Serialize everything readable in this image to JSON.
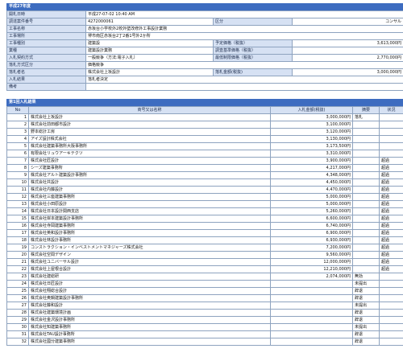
{
  "section1": {
    "title": "平成27年度",
    "rows": [
      {
        "label": "開札日時",
        "value": "平成27-07-02 10:40 AM"
      },
      {
        "label": "調達案件番号",
        "value": "4272000061",
        "label2": "区分",
        "value2": "コンサル"
      },
      {
        "label": "工事名称",
        "value": "赤坂台小学校外2校外壁改修外工事設計業務"
      },
      {
        "label": "工事場所",
        "value": "堺市南区赤坂台2丁2番1号外2か所"
      },
      {
        "label": "工事種別",
        "value": "建築設",
        "label2": "予定価格（税抜）",
        "value2": "3,613,000円"
      },
      {
        "label": "業種",
        "value": "建築設計業務",
        "label2": "調査基準価格（税抜）",
        "value2": ""
      },
      {
        "label": "入札契約方式",
        "value": "一般競争（方法:電子入札）",
        "label2": "最低制限価格（税抜）",
        "value2": "2,770,000円"
      },
      {
        "label": "落札方式区分",
        "value": "価格競争"
      },
      {
        "label": "落札者名",
        "value": "株式会社上坂設計",
        "label2": "落札金額(税抜)",
        "value2": "3,000,000円"
      },
      {
        "label": "入札結果",
        "value": "落札者決定"
      },
      {
        "label": "備考",
        "value": ""
      }
    ]
  },
  "section2": {
    "title": "第1回入札結果",
    "headers": {
      "no": "No",
      "name": "商号又は名称",
      "amount": "入札金額(税抜)",
      "summary": "摘要",
      "status": "状況"
    },
    "rows": [
      {
        "no": "1",
        "name": "株式会社上坂設計",
        "amount": "3,000,000円",
        "summary": "落札",
        "status": ""
      },
      {
        "no": "2",
        "name": "株式会社前田都市設計",
        "amount": "3,100,000円",
        "summary": "",
        "status": ""
      },
      {
        "no": "3",
        "name": "野本総計工房",
        "amount": "3,120,000円",
        "summary": "",
        "status": ""
      },
      {
        "no": "4",
        "name": "アイズ設計株式会社",
        "amount": "3,130,000円",
        "summary": "",
        "status": ""
      },
      {
        "no": "5",
        "name": "株式会社建築事務所大阪事務所",
        "amount": "3,173,500円",
        "summary": "",
        "status": ""
      },
      {
        "no": "6",
        "name": "有限会社リュウアーキテクツ",
        "amount": "3,310,000円",
        "summary": "",
        "status": ""
      },
      {
        "no": "7",
        "name": "株式会社匠設計",
        "amount": "3,900,000円",
        "summary": "",
        "status": "超過"
      },
      {
        "no": "8",
        "name": "シーズ建築事務所",
        "amount": "4,217,000円",
        "summary": "",
        "status": "超過"
      },
      {
        "no": "9",
        "name": "株式会社アルト建築設計事務所",
        "amount": "4,348,000円",
        "summary": "",
        "status": "超過"
      },
      {
        "no": "10",
        "name": "株式会社共設計",
        "amount": "4,450,000円",
        "summary": "",
        "status": "超過"
      },
      {
        "no": "11",
        "name": "株式会社内藤設計",
        "amount": "4,470,000円",
        "summary": "",
        "status": "超過"
      },
      {
        "no": "12",
        "name": "株式会社三座建築事務所",
        "amount": "5,000,000円",
        "summary": "",
        "status": "超過"
      },
      {
        "no": "13",
        "name": "株式会社小田原設計",
        "amount": "5,000,000円",
        "summary": "",
        "status": "超過"
      },
      {
        "no": "14",
        "name": "株式会社日本設計関西支店",
        "amount": "5,260,000円",
        "summary": "",
        "status": "超過"
      },
      {
        "no": "15",
        "name": "株式会社岸本建築設計事務所",
        "amount": "6,600,000円",
        "summary": "",
        "status": "超過"
      },
      {
        "no": "16",
        "name": "株式会社寺岡建築事務所",
        "amount": "6,740,000円",
        "summary": "",
        "status": "超過"
      },
      {
        "no": "17",
        "name": "株式会社英和設計事務所",
        "amount": "6,900,000円",
        "summary": "",
        "status": "超過"
      },
      {
        "no": "18",
        "name": "株式会社林設計事務所",
        "amount": "6,930,000円",
        "summary": "",
        "status": "超過"
      },
      {
        "no": "19",
        "name": "コンストラクション・インベストメントマネジャーズ株式会社",
        "amount": "7,200,000円",
        "summary": "",
        "status": "超過"
      },
      {
        "no": "20",
        "name": "株式会社空間デザイン",
        "amount": "9,560,000円",
        "summary": "",
        "status": "超過"
      },
      {
        "no": "21",
        "name": "株式会社ユニバーサル設計",
        "amount": "12,000,000円",
        "summary": "",
        "status": "超過"
      },
      {
        "no": "22",
        "name": "株式会社上屋根合設計",
        "amount": "12,210,000円",
        "summary": "",
        "status": "超過"
      },
      {
        "no": "23",
        "name": "株式会社建総研",
        "amount": "2,074,000円",
        "summary": "無効",
        "status": ""
      },
      {
        "no": "24",
        "name": "株式会社日匠設計",
        "amount": "",
        "summary": "未提出",
        "status": ""
      },
      {
        "no": "25",
        "name": "株式会社翔総合設計",
        "amount": "",
        "summary": "辞退",
        "status": ""
      },
      {
        "no": "26",
        "name": "株式会社奥鍋建築設計事務所",
        "amount": "",
        "summary": "辞退",
        "status": ""
      },
      {
        "no": "27",
        "name": "株式会社藤和設計",
        "amount": "",
        "summary": "未提出",
        "status": ""
      },
      {
        "no": "28",
        "name": "株式会社建築環境計画",
        "amount": "",
        "summary": "辞退",
        "status": ""
      },
      {
        "no": "29",
        "name": "株式会社金沢設計事務所",
        "amount": "",
        "summary": "辞退",
        "status": ""
      },
      {
        "no": "30",
        "name": "株式会社知建築事務所",
        "amount": "",
        "summary": "未提出",
        "status": ""
      },
      {
        "no": "31",
        "name": "株式会社TAU設計事務所",
        "amount": "",
        "summary": "辞退",
        "status": ""
      },
      {
        "no": "32",
        "name": "株式会社國分建築事務所",
        "amount": "",
        "summary": "辞退",
        "status": ""
      }
    ]
  }
}
